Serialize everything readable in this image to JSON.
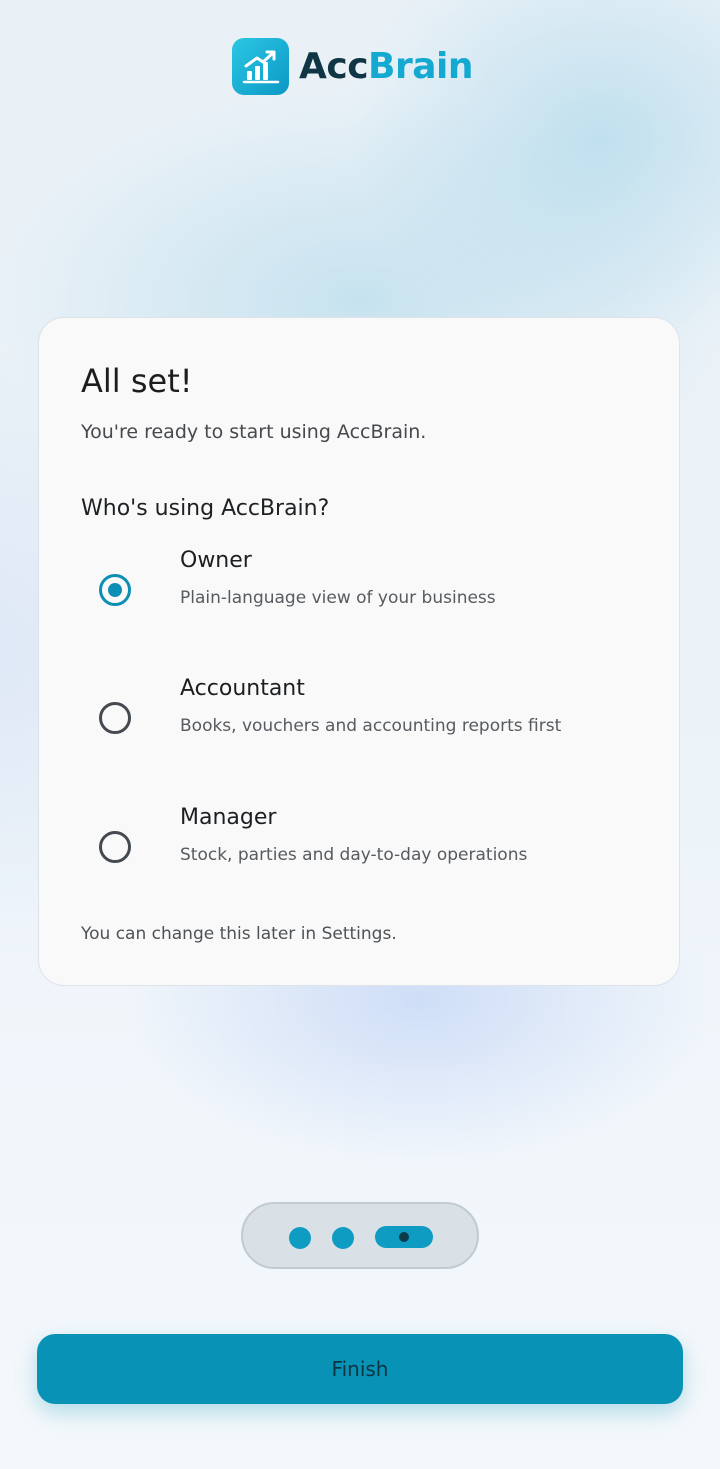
{
  "app": {
    "logo_part1": "Acc",
    "logo_part2": "Brain",
    "logo_icon": "bar-chart-growth-icon",
    "accent_color": "#0892b6"
  },
  "card": {
    "title": "All set!",
    "subtitle": "You're ready to start using AccBrain.",
    "question": "Who's using AccBrain?",
    "options": [
      {
        "label": "Owner",
        "description": "Plain-language view of your business",
        "selected": true
      },
      {
        "label": "Accountant",
        "description": "Books, vouchers and accounting reports first",
        "selected": false
      },
      {
        "label": "Manager",
        "description": "Stock, parties and day-to-day operations",
        "selected": false
      }
    ],
    "note": "You can change this later in Settings."
  },
  "pager": {
    "total_pages": 3,
    "current_page": 3
  },
  "actions": {
    "finish_label": "Finish"
  }
}
